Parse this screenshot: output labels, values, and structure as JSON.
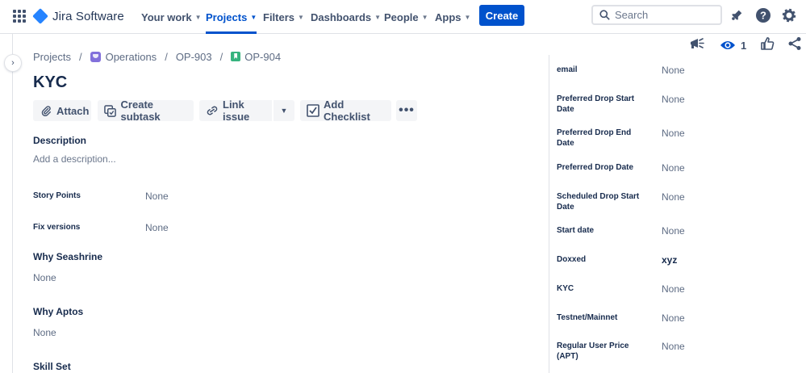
{
  "app": {
    "name": "Jira Software"
  },
  "nav": {
    "your_work": "Your work",
    "projects": "Projects",
    "filters": "Filters",
    "dashboards": "Dashboards",
    "people": "People",
    "apps": "Apps",
    "create": "Create",
    "search_placeholder": "Search"
  },
  "breadcrumb": {
    "projects": "Projects",
    "project": "Operations",
    "parent": "OP-903",
    "issue": "OP-904"
  },
  "issue": {
    "title": "KYC",
    "watchers": "1"
  },
  "toolbar": {
    "attach": "Attach",
    "create_subtask": "Create subtask",
    "link_issue": "Link issue",
    "add_checklist": "Add Checklist"
  },
  "description": {
    "label": "Description",
    "placeholder": "Add a description..."
  },
  "fields": {
    "story_points": {
      "label": "Story Points",
      "value": "None"
    },
    "fix_versions": {
      "label": "Fix versions",
      "value": "None"
    }
  },
  "sections": [
    {
      "heading": "Why Seashrine",
      "value": "None"
    },
    {
      "heading": "Why Aptos",
      "value": "None"
    },
    {
      "heading": "Skill Set",
      "value": ""
    }
  ],
  "details": [
    {
      "label": "email",
      "value": "None"
    },
    {
      "label": "Preferred Drop Start Date",
      "value": "None"
    },
    {
      "label": "Preferred Drop End Date",
      "value": "None"
    },
    {
      "label": "Preferred Drop Date",
      "value": "None"
    },
    {
      "label": "Scheduled Drop Start Date",
      "value": "None"
    },
    {
      "label": "Start date",
      "value": "None"
    },
    {
      "label": "Doxxed",
      "value": "xyz"
    },
    {
      "label": "KYC",
      "value": "None"
    },
    {
      "label": "Testnet/Mainnet",
      "value": "None"
    },
    {
      "label": "Regular User Price (APT)",
      "value": "None"
    }
  ],
  "colors": {
    "brand": "#0052cc",
    "text": "#172b4d",
    "subtle": "#5e6c84",
    "story": "#36b37e",
    "project": "#8270db"
  }
}
